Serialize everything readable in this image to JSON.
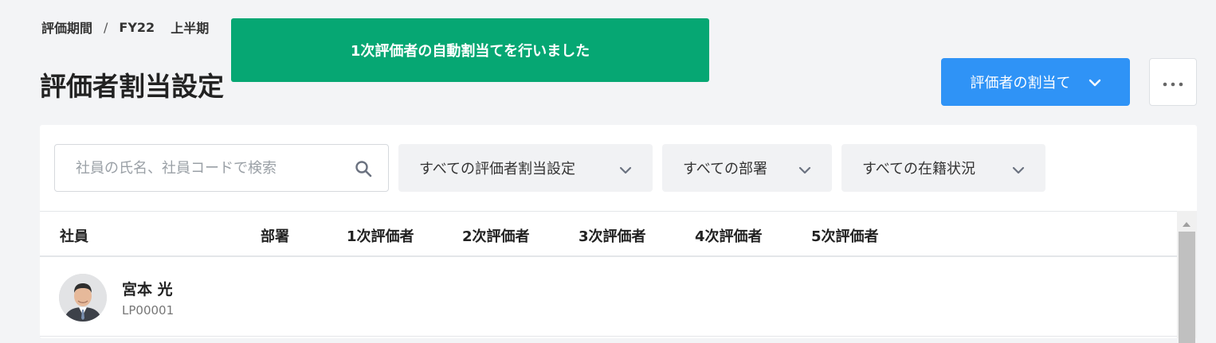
{
  "breadcrumb": {
    "root": "評価期間",
    "separator": "/",
    "period": "FY22",
    "term": "上半期"
  },
  "toast": {
    "message": "1次評価者の自動割当てを行いました",
    "color": "#06a773"
  },
  "page": {
    "title": "評価者割当設定"
  },
  "actions": {
    "assign_label": "評価者の割当て",
    "assign_icon": "chevron-down-icon",
    "more_icon": "more-horizontal-icon",
    "accent": "#2f93f6"
  },
  "search": {
    "placeholder": "社員の氏名、社員コードで検索",
    "value": "",
    "icon": "search-icon"
  },
  "filters": [
    {
      "label": "すべての評価者割当設定"
    },
    {
      "label": "すべての部署"
    },
    {
      "label": "すべての在籍状況"
    }
  ],
  "table": {
    "columns": [
      "社員",
      "部署",
      "1次評価者",
      "2次評価者",
      "3次評価者",
      "4次評価者",
      "5次評価者"
    ],
    "rows": [
      {
        "name": "宮本 光",
        "code": "LP00001",
        "department": "",
        "evaluators": [
          "",
          "",
          "",
          "",
          ""
        ]
      }
    ]
  }
}
